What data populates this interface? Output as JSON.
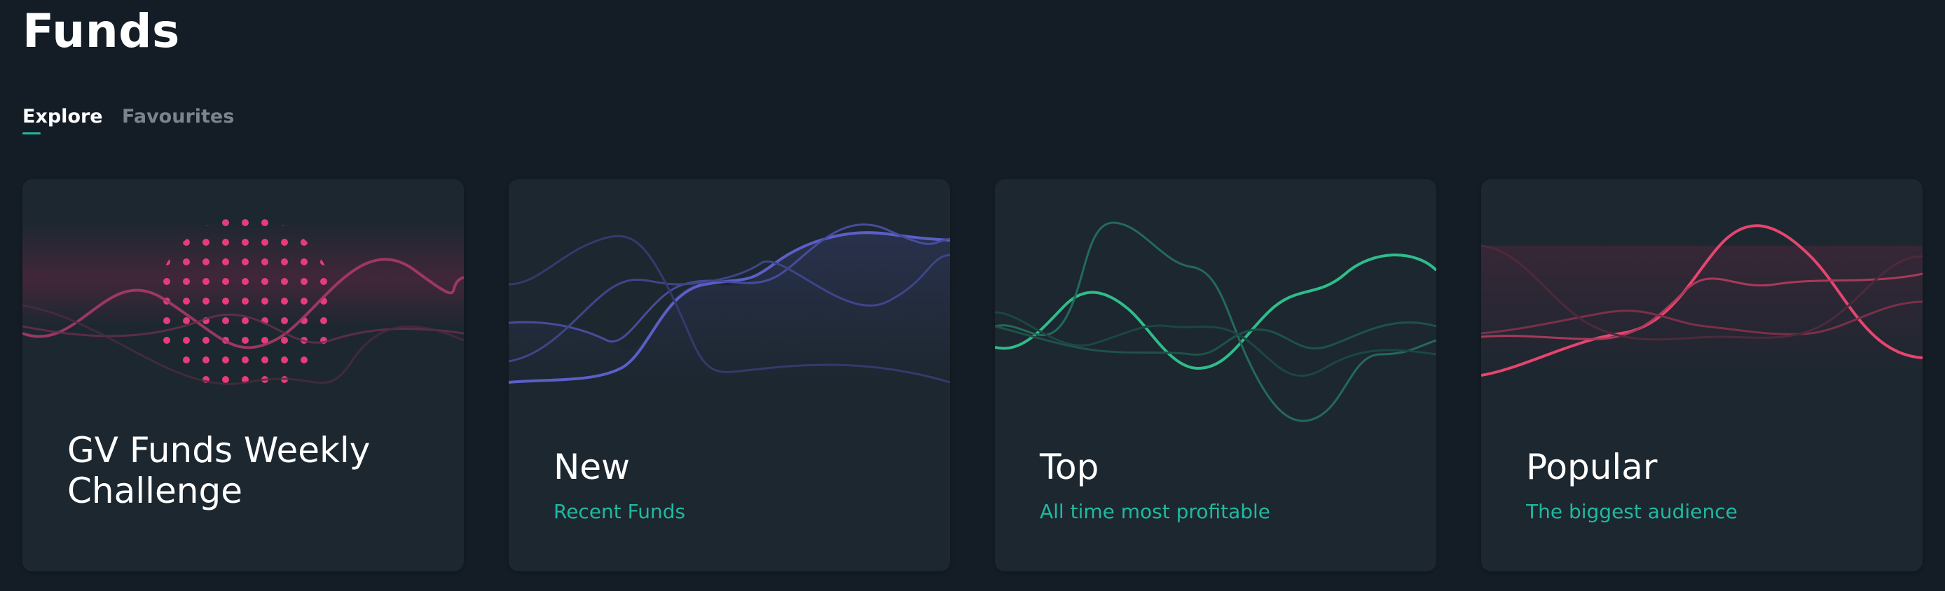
{
  "page": {
    "title": "Funds"
  },
  "tabs": [
    {
      "label": "Explore",
      "active": true
    },
    {
      "label": "Favourites",
      "active": false
    }
  ],
  "cards": [
    {
      "title_line1": "GV Funds Weekly",
      "title_line2": "Challenge",
      "subtitle": "",
      "art": "dot-globe-and-waves",
      "color": "#e63d7a"
    },
    {
      "title": "New",
      "subtitle": "Recent Funds",
      "art": "waves",
      "color": "#5b5fc7"
    },
    {
      "title": "Top",
      "subtitle": "All time most profitable",
      "art": "waves",
      "color": "#2ebd8a"
    },
    {
      "title": "Popular",
      "subtitle": "The biggest audience",
      "art": "waves",
      "color": "#e6456f"
    }
  ],
  "colors": {
    "background": "#141d25",
    "card": "#1d2730",
    "accent": "#1fb9a2",
    "tab_inactive": "#79848f"
  }
}
